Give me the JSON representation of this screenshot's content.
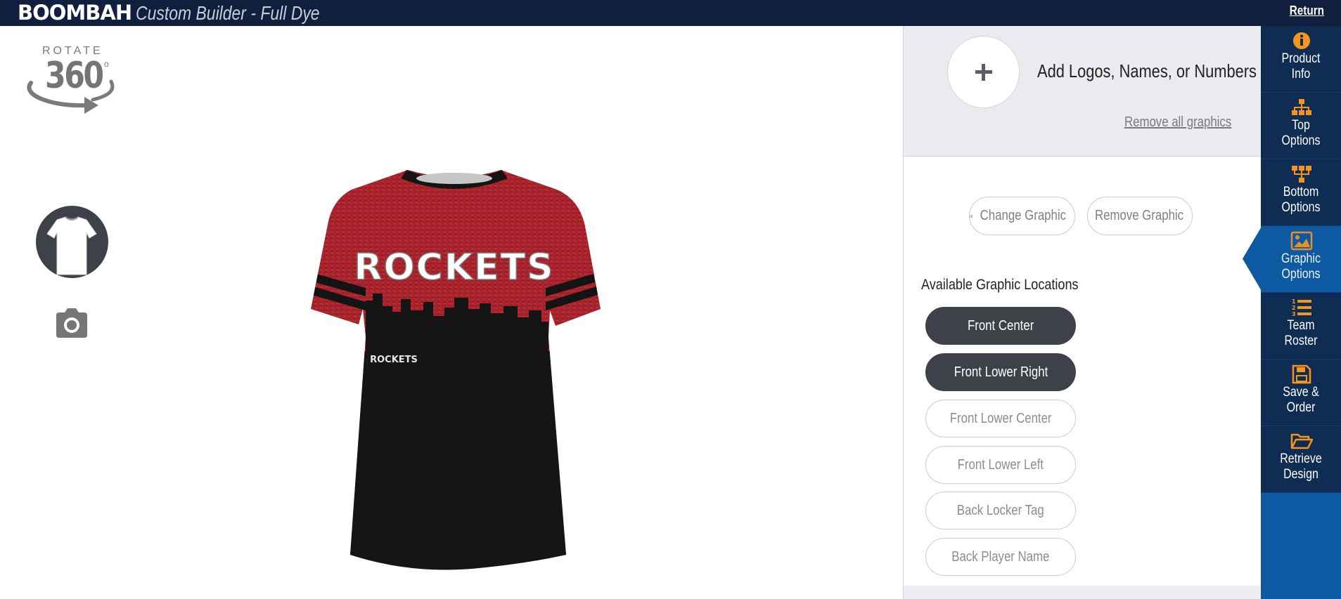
{
  "header": {
    "brand": "BOOMBAH",
    "subtitle": "Custom Builder - Full Dye",
    "return_label": "Return"
  },
  "rotate": {
    "word": "ROTATE",
    "number": "360",
    "degree": "o"
  },
  "product": {
    "front_text": "ROCKETS",
    "corner_text": "ROCKETS",
    "colors": {
      "top": "#a8232b",
      "bottom": "#151515",
      "stripe": "#141414"
    }
  },
  "panel": {
    "add_label": "Add Logos, Names, or Numbers",
    "remove_all": "Remove all graphics",
    "change_graphic": "Change Graphic",
    "remove_graphic": "Remove Graphic",
    "locations_title": "Available Graphic Locations",
    "locations": [
      {
        "label": "Front Center",
        "active": true
      },
      {
        "label": "Front Lower Right",
        "active": true
      },
      {
        "label": "Front Lower Center",
        "active": false
      },
      {
        "label": "Front Lower Left",
        "active": false
      },
      {
        "label": "Back Locker Tag",
        "active": false
      },
      {
        "label": "Back Player Name",
        "active": false
      }
    ]
  },
  "nav": {
    "accent": "#f7941d",
    "items": [
      {
        "line1": "Product",
        "line2": "Info",
        "icon": "info-icon"
      },
      {
        "line1": "Top",
        "line2": "Options",
        "icon": "sitemap-icon"
      },
      {
        "line1": "Bottom",
        "line2": "Options",
        "icon": "sitemap-down-icon"
      },
      {
        "line1": "Graphic",
        "line2": "Options",
        "icon": "image-icon"
      },
      {
        "line1": "Team",
        "line2": "Roster",
        "icon": "numbered-list-icon"
      },
      {
        "line1": "Save &",
        "line2": "Order",
        "icon": "floppy-icon"
      },
      {
        "line1": "Retrieve",
        "line2": "Design",
        "icon": "folder-open-icon"
      }
    ]
  }
}
